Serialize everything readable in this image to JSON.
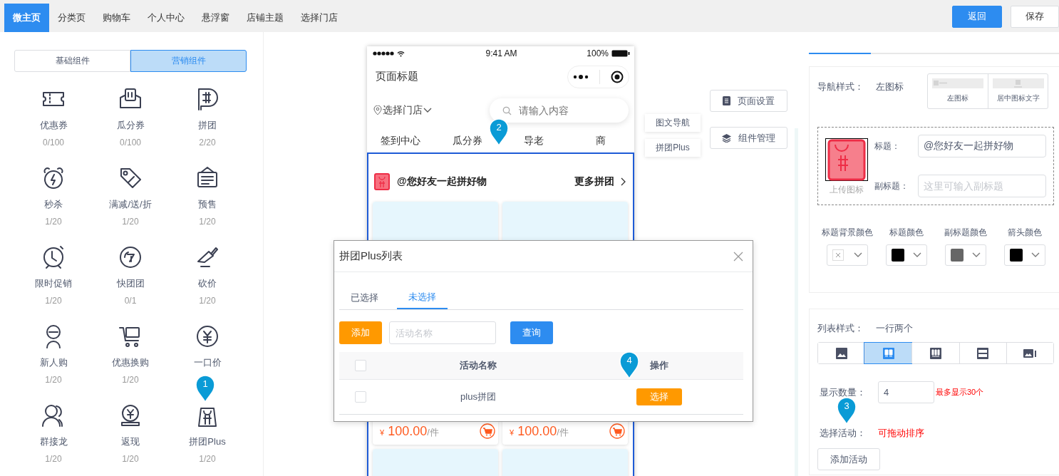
{
  "top_tabs": [
    {
      "label": "微主页",
      "selected": true
    },
    {
      "label": "分类页",
      "selected": false
    },
    {
      "label": "购物车",
      "selected": false
    },
    {
      "label": "个人中心",
      "selected": false
    },
    {
      "label": "悬浮窗",
      "selected": false
    },
    {
      "label": "店铺主题",
      "selected": false
    },
    {
      "label": "选择门店",
      "selected": false
    }
  ],
  "header_buttons": [
    {
      "label": "返回",
      "kind": "primary"
    },
    {
      "label": "保存",
      "kind": "default"
    }
  ],
  "component_tabs": [
    {
      "label": "基础组件",
      "selected": false
    },
    {
      "label": "营销组件",
      "selected": true
    }
  ],
  "components": [
    {
      "label": "优惠券",
      "count": "0/100"
    },
    {
      "label": "瓜分券",
      "count": "0/100"
    },
    {
      "label": "拼团",
      "count": "2/20"
    },
    {
      "label": "秒杀",
      "count": "1/20"
    },
    {
      "label": "满减/送/折",
      "count": "1/20"
    },
    {
      "label": "预售",
      "count": "1/20"
    },
    {
      "label": "限时促销",
      "count": "1/20"
    },
    {
      "label": "快团团",
      "count": "0/1"
    },
    {
      "label": "砍价",
      "count": "1/20"
    },
    {
      "label": "新人购",
      "count": "1/20"
    },
    {
      "label": "优惠换购",
      "count": "1/20"
    },
    {
      "label": "一口价"
    },
    {
      "label": "群接龙",
      "count": "1/20"
    },
    {
      "label": "返现",
      "count": "1/20"
    },
    {
      "label": "拼团Plus",
      "count": "1/20"
    }
  ],
  "phone": {
    "time": "9:41 AM",
    "battery": "100%",
    "page_title": "页面标题",
    "store_selector": "选择门店",
    "search": {
      "placeholder": "请输入内容"
    },
    "nav_tabs": [
      "签到中心",
      "瓜分券",
      "导老",
      "商"
    ],
    "group_title": "@您好友一起拼好物",
    "group_more": "更多拼团",
    "products": [
      {
        "currency": "¥",
        "price": "100.00",
        "unit": "/件"
      },
      {
        "currency": "¥",
        "price": "100.00",
        "unit": "/件"
      }
    ]
  },
  "layer_labels": [
    "图文导航",
    "拼团Plus"
  ],
  "side_buttons": [
    {
      "label": "页面设置",
      "kind": "page"
    },
    {
      "label": "组件管理",
      "kind": "layers"
    }
  ],
  "settings": {
    "nav_style": {
      "label": "导航样式：",
      "value": "左图标",
      "options": [
        {
          "label": "左图标",
          "kind": "left"
        },
        {
          "label": "居中图标文字",
          "kind": "center"
        }
      ]
    },
    "upload_label": "上传图标",
    "title_field": {
      "label": "标题：",
      "value": "@您好友一起拼好物"
    },
    "subtitle_field": {
      "label": "副标题：",
      "placeholder": "这里可输入副标题"
    },
    "colors": [
      {
        "label": "标题背景颜色"
      },
      {
        "label": "标题颜色",
        "color": "#000000"
      },
      {
        "label": "副标题颜色",
        "color": "#666666"
      },
      {
        "label": "箭头颜色",
        "color": "#000000"
      }
    ],
    "list_style": {
      "label": "列表样式：",
      "value": "一行两个",
      "options": [
        {
          "kind": "large",
          "selected": false
        },
        {
          "kind": "two",
          "selected": true
        },
        {
          "kind": "three",
          "selected": false
        },
        {
          "kind": "list",
          "selected": false
        },
        {
          "kind": "mixed",
          "selected": false
        }
      ]
    },
    "count_field": {
      "label": "显示数量：",
      "value": "4",
      "hint": "最多显示30个"
    },
    "activity": {
      "label": "选择活动：",
      "hint": "可拖动排序"
    },
    "add_button": "添加活动"
  },
  "modal": {
    "title": "拼团Plus列表",
    "tabs": [
      {
        "label": "已选择",
        "selected": false
      },
      {
        "label": "未选择",
        "selected": true
      }
    ],
    "add_button": "添加",
    "search": {
      "placeholder": "活动名称"
    },
    "query_button": "查询",
    "columns": [
      "活动名称",
      "操作"
    ],
    "header_checked": false,
    "rows": [
      {
        "name": "plus拼团",
        "checked": false,
        "action": "选择"
      }
    ]
  },
  "markers": [
    "1",
    "2",
    "3",
    "4"
  ]
}
